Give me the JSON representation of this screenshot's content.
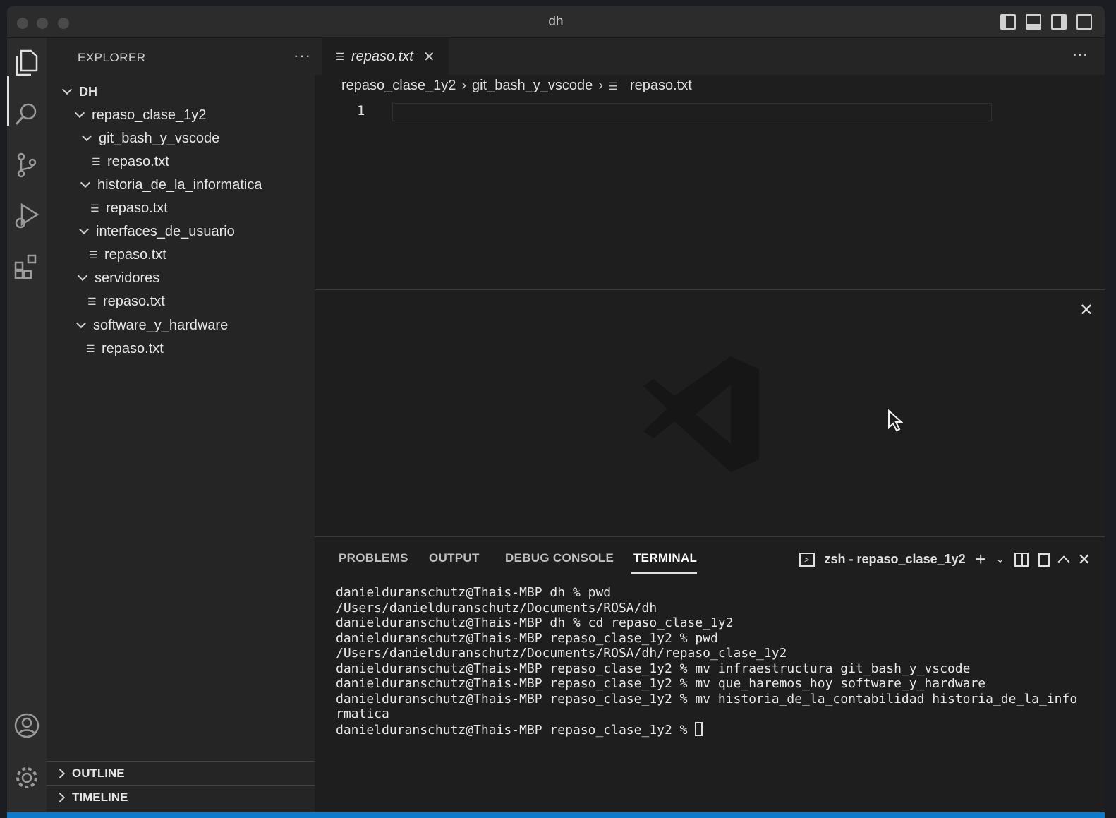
{
  "window": {
    "title": "dh"
  },
  "activity_bar": {
    "items": [
      "explorer-icon",
      "search-icon",
      "source-control-icon",
      "run-debug-icon",
      "extensions-icon"
    ],
    "bottom": [
      "account-icon",
      "settings-gear-icon"
    ]
  },
  "sidebar": {
    "header": "EXPLORER",
    "more": "···",
    "root": "DH",
    "tree": [
      {
        "label": "repaso_clase_1y2",
        "type": "folder"
      },
      {
        "label": "git_bash_y_vscode",
        "type": "folder"
      },
      {
        "label": "repaso.txt",
        "type": "file"
      },
      {
        "label": "historia_de_la_informatica",
        "type": "folder"
      },
      {
        "label": "repaso.txt",
        "type": "file"
      },
      {
        "label": "interfaces_de_usuario",
        "type": "folder"
      },
      {
        "label": "repaso.txt",
        "type": "file"
      },
      {
        "label": "servidores",
        "type": "folder"
      },
      {
        "label": "repaso.txt",
        "type": "file"
      },
      {
        "label": "software_y_hardware",
        "type": "folder"
      },
      {
        "label": "repaso.txt",
        "type": "file"
      }
    ],
    "sections": [
      "OUTLINE",
      "TIMELINE"
    ]
  },
  "editor": {
    "tab": {
      "label": "repaso.txt",
      "close": "✕"
    },
    "more": "···",
    "breadcrumb": [
      "repaso_clase_1y2",
      "git_bash_y_vscode",
      "repaso.txt"
    ],
    "line_number": "1",
    "welcome_close": "✕"
  },
  "panel": {
    "tabs": [
      "PROBLEMS",
      "OUTPUT",
      "DEBUG CONSOLE",
      "TERMINAL"
    ],
    "active_tab": "TERMINAL",
    "terminal_name": "zsh - repaso_clase_1y2",
    "terminal_lines": [
      "danielduranschutz@Thais-MBP dh % pwd",
      "/Users/danielduranschutz/Documents/ROSA/dh",
      "danielduranschutz@Thais-MBP dh % cd repaso_clase_1y2",
      "danielduranschutz@Thais-MBP repaso_clase_1y2 % pwd",
      "/Users/danielduranschutz/Documents/ROSA/dh/repaso_clase_1y2",
      "danielduranschutz@Thais-MBP repaso_clase_1y2 % mv infraestructura git_bash_y_vscode",
      "danielduranschutz@Thais-MBP repaso_clase_1y2 % mv que_haremos_hoy software_y_hardware",
      "danielduranschutz@Thais-MBP repaso_clase_1y2 % mv historia_de_la_contabilidad historia_de_la_info",
      "rmatica"
    ],
    "prompt": "danielduranschutz@Thais-MBP repaso_clase_1y2 % "
  },
  "colors": {
    "accent": "#0e7acc",
    "background": "#1e1e1e",
    "sidebar": "#252526"
  }
}
